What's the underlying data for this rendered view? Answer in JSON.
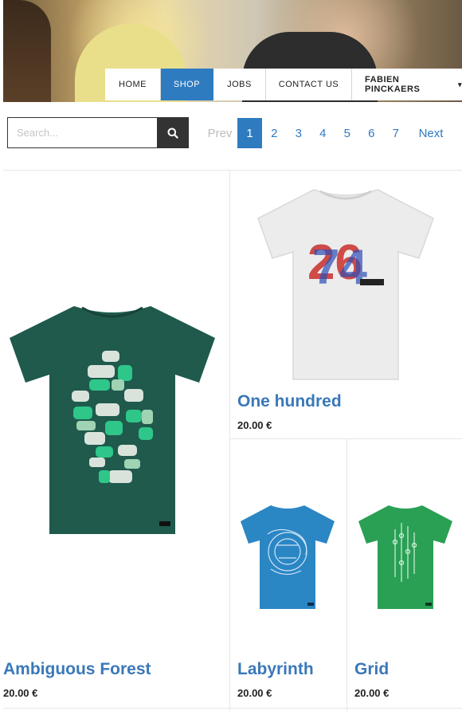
{
  "nav": {
    "items": [
      {
        "label": "HOME",
        "active": false
      },
      {
        "label": "SHOP",
        "active": true
      },
      {
        "label": "JOBS",
        "active": false
      },
      {
        "label": "CONTACT US",
        "active": false
      }
    ],
    "user": "FABIEN PINCKAERS"
  },
  "search": {
    "placeholder": "Search...",
    "value": ""
  },
  "pagination": {
    "prev": "Prev",
    "pages": [
      "1",
      "2",
      "3",
      "4",
      "5",
      "6",
      "7"
    ],
    "current": "1",
    "next": "Next"
  },
  "products": [
    {
      "title": "Ambiguous Forest",
      "price": "20.00 €",
      "shirt_color": "#1f5a4c"
    },
    {
      "title": "One hundred",
      "price": "20.00 €",
      "shirt_color": "#f1f1f1"
    },
    {
      "title": "Labyrinth",
      "price": "20.00 €",
      "shirt_color": "#2b86c4"
    },
    {
      "title": "Grid",
      "price": "20.00 €",
      "shirt_color": "#2aa055"
    }
  ],
  "colors": {
    "accent": "#2f7bbf",
    "title": "#3a78b8"
  }
}
